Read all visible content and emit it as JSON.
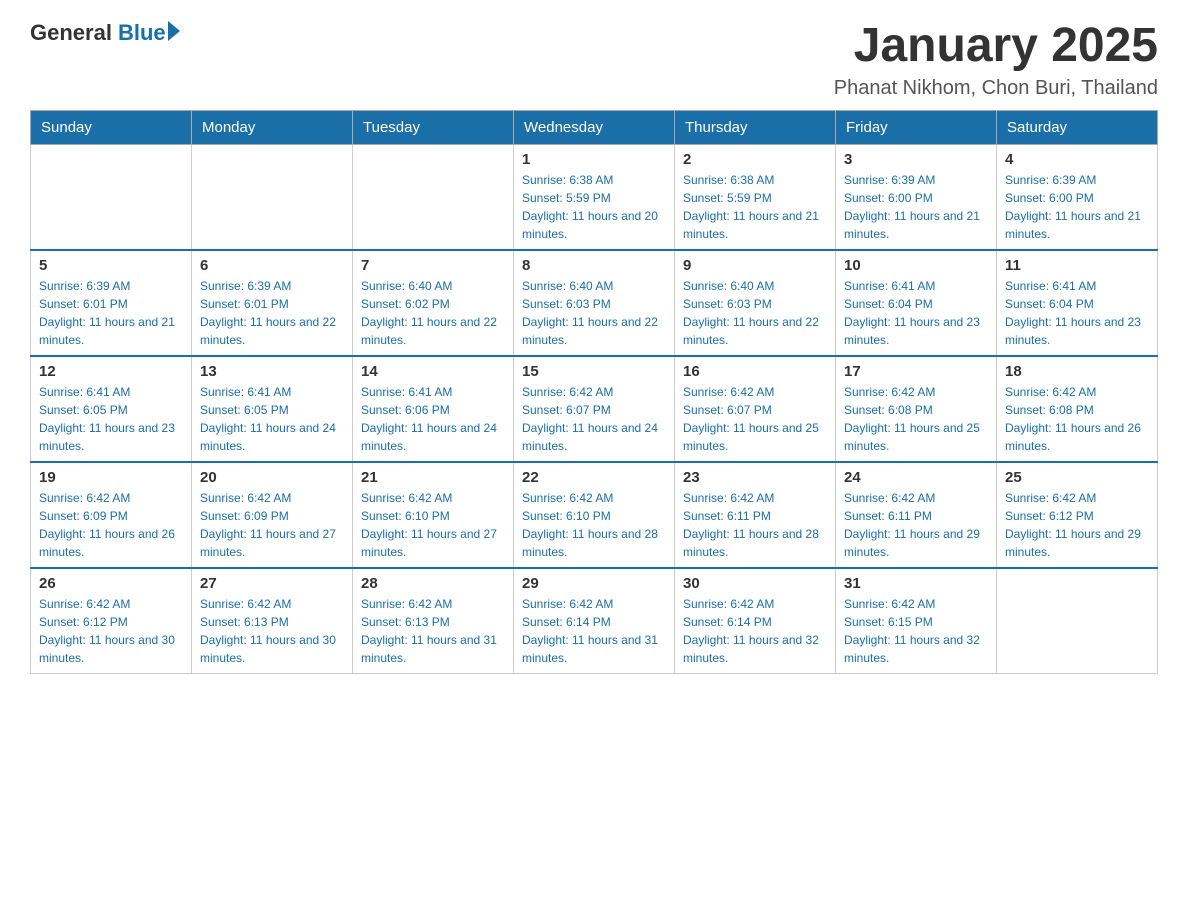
{
  "header": {
    "logo": {
      "text_general": "General",
      "text_blue": "Blue",
      "arrow": true
    },
    "title": "January 2025",
    "location": "Phanat Nikhom, Chon Buri, Thailand"
  },
  "days_of_week": [
    "Sunday",
    "Monday",
    "Tuesday",
    "Wednesday",
    "Thursday",
    "Friday",
    "Saturday"
  ],
  "weeks": [
    [
      {
        "day": "",
        "info": ""
      },
      {
        "day": "",
        "info": ""
      },
      {
        "day": "",
        "info": ""
      },
      {
        "day": "1",
        "sunrise": "6:38 AM",
        "sunset": "5:59 PM",
        "daylight": "11 hours and 20 minutes."
      },
      {
        "day": "2",
        "sunrise": "6:38 AM",
        "sunset": "5:59 PM",
        "daylight": "11 hours and 21 minutes."
      },
      {
        "day": "3",
        "sunrise": "6:39 AM",
        "sunset": "6:00 PM",
        "daylight": "11 hours and 21 minutes."
      },
      {
        "day": "4",
        "sunrise": "6:39 AM",
        "sunset": "6:00 PM",
        "daylight": "11 hours and 21 minutes."
      }
    ],
    [
      {
        "day": "5",
        "sunrise": "6:39 AM",
        "sunset": "6:01 PM",
        "daylight": "11 hours and 21 minutes."
      },
      {
        "day": "6",
        "sunrise": "6:39 AM",
        "sunset": "6:01 PM",
        "daylight": "11 hours and 22 minutes."
      },
      {
        "day": "7",
        "sunrise": "6:40 AM",
        "sunset": "6:02 PM",
        "daylight": "11 hours and 22 minutes."
      },
      {
        "day": "8",
        "sunrise": "6:40 AM",
        "sunset": "6:03 PM",
        "daylight": "11 hours and 22 minutes."
      },
      {
        "day": "9",
        "sunrise": "6:40 AM",
        "sunset": "6:03 PM",
        "daylight": "11 hours and 22 minutes."
      },
      {
        "day": "10",
        "sunrise": "6:41 AM",
        "sunset": "6:04 PM",
        "daylight": "11 hours and 23 minutes."
      },
      {
        "day": "11",
        "sunrise": "6:41 AM",
        "sunset": "6:04 PM",
        "daylight": "11 hours and 23 minutes."
      }
    ],
    [
      {
        "day": "12",
        "sunrise": "6:41 AM",
        "sunset": "6:05 PM",
        "daylight": "11 hours and 23 minutes."
      },
      {
        "day": "13",
        "sunrise": "6:41 AM",
        "sunset": "6:05 PM",
        "daylight": "11 hours and 24 minutes."
      },
      {
        "day": "14",
        "sunrise": "6:41 AM",
        "sunset": "6:06 PM",
        "daylight": "11 hours and 24 minutes."
      },
      {
        "day": "15",
        "sunrise": "6:42 AM",
        "sunset": "6:07 PM",
        "daylight": "11 hours and 24 minutes."
      },
      {
        "day": "16",
        "sunrise": "6:42 AM",
        "sunset": "6:07 PM",
        "daylight": "11 hours and 25 minutes."
      },
      {
        "day": "17",
        "sunrise": "6:42 AM",
        "sunset": "6:08 PM",
        "daylight": "11 hours and 25 minutes."
      },
      {
        "day": "18",
        "sunrise": "6:42 AM",
        "sunset": "6:08 PM",
        "daylight": "11 hours and 26 minutes."
      }
    ],
    [
      {
        "day": "19",
        "sunrise": "6:42 AM",
        "sunset": "6:09 PM",
        "daylight": "11 hours and 26 minutes."
      },
      {
        "day": "20",
        "sunrise": "6:42 AM",
        "sunset": "6:09 PM",
        "daylight": "11 hours and 27 minutes."
      },
      {
        "day": "21",
        "sunrise": "6:42 AM",
        "sunset": "6:10 PM",
        "daylight": "11 hours and 27 minutes."
      },
      {
        "day": "22",
        "sunrise": "6:42 AM",
        "sunset": "6:10 PM",
        "daylight": "11 hours and 28 minutes."
      },
      {
        "day": "23",
        "sunrise": "6:42 AM",
        "sunset": "6:11 PM",
        "daylight": "11 hours and 28 minutes."
      },
      {
        "day": "24",
        "sunrise": "6:42 AM",
        "sunset": "6:11 PM",
        "daylight": "11 hours and 29 minutes."
      },
      {
        "day": "25",
        "sunrise": "6:42 AM",
        "sunset": "6:12 PM",
        "daylight": "11 hours and 29 minutes."
      }
    ],
    [
      {
        "day": "26",
        "sunrise": "6:42 AM",
        "sunset": "6:12 PM",
        "daylight": "11 hours and 30 minutes."
      },
      {
        "day": "27",
        "sunrise": "6:42 AM",
        "sunset": "6:13 PM",
        "daylight": "11 hours and 30 minutes."
      },
      {
        "day": "28",
        "sunrise": "6:42 AM",
        "sunset": "6:13 PM",
        "daylight": "11 hours and 31 minutes."
      },
      {
        "day": "29",
        "sunrise": "6:42 AM",
        "sunset": "6:14 PM",
        "daylight": "11 hours and 31 minutes."
      },
      {
        "day": "30",
        "sunrise": "6:42 AM",
        "sunset": "6:14 PM",
        "daylight": "11 hours and 32 minutes."
      },
      {
        "day": "31",
        "sunrise": "6:42 AM",
        "sunset": "6:15 PM",
        "daylight": "11 hours and 32 minutes."
      },
      {
        "day": "",
        "info": ""
      }
    ]
  ]
}
